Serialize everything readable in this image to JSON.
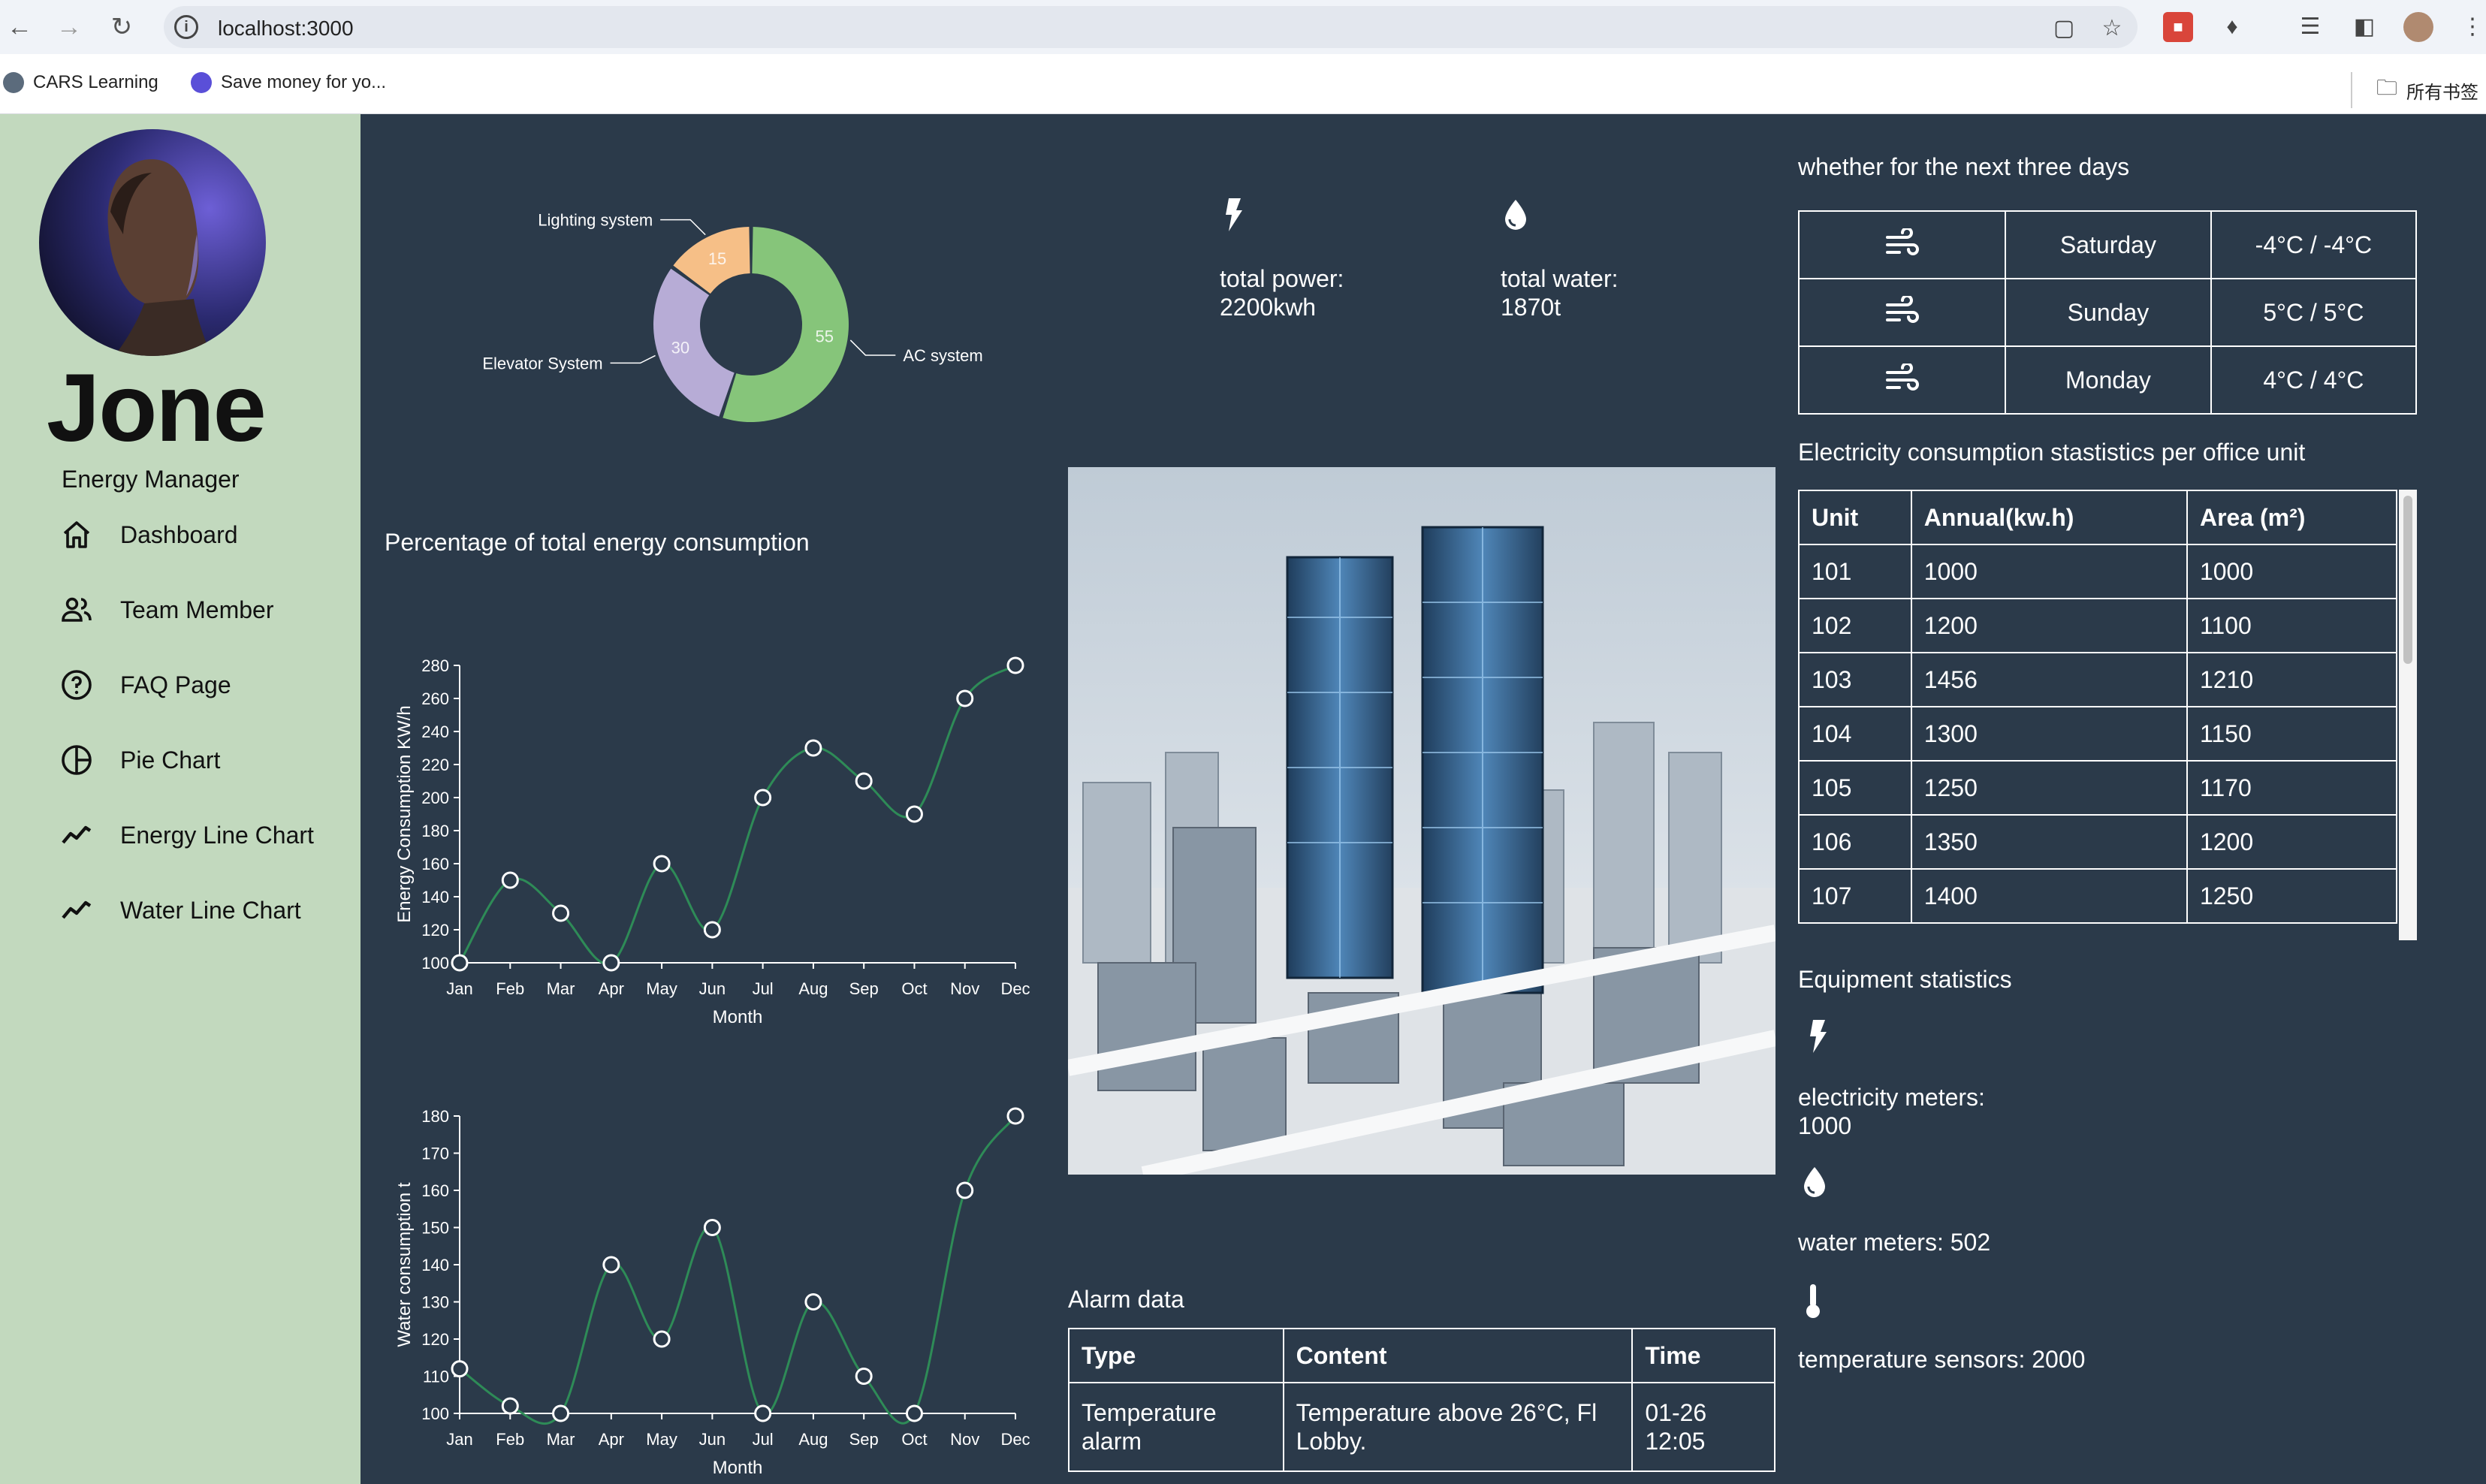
{
  "browser": {
    "url": "localhost:3000",
    "bookmarks": [
      {
        "label": "CARS Learning"
      },
      {
        "label": "Save money for yo..."
      }
    ],
    "bookmarks_folder": "所有书签"
  },
  "sidebar": {
    "user_name": "Jone",
    "user_role": "Energy Manager",
    "items": [
      {
        "label": "Dashboard",
        "icon": "home-icon"
      },
      {
        "label": "Team Member",
        "icon": "people-icon"
      },
      {
        "label": "FAQ Page",
        "icon": "help-circle-icon"
      },
      {
        "label": "Pie Chart",
        "icon": "pie-chart-icon"
      },
      {
        "label": "Energy Line Chart",
        "icon": "timeline-icon"
      },
      {
        "label": "Water Line Chart",
        "icon": "timeline-icon"
      }
    ]
  },
  "totals": {
    "power_label": "total power:",
    "power_value": "2200kwh",
    "water_label": "total water:",
    "water_value": "1870t"
  },
  "energy_title": "Percentage of total energy consumption",
  "weather": {
    "title": "whether for the next three days",
    "rows": [
      {
        "icon": "wind-icon",
        "day": "Saturday",
        "temp": "-4°C / -4°C"
      },
      {
        "icon": "wind-icon",
        "day": "Sunday",
        "temp": "5°C / 5°C"
      },
      {
        "icon": "wind-icon",
        "day": "Monday",
        "temp": "4°C / 4°C"
      }
    ]
  },
  "units": {
    "title": "Electricity consumption stastistics per office unit",
    "headers": [
      "Unit",
      "Annual(kw.h)",
      "Area (m²)"
    ],
    "rows": [
      [
        "101",
        "1000",
        "1000"
      ],
      [
        "102",
        "1200",
        "1100"
      ],
      [
        "103",
        "1456",
        "1210"
      ],
      [
        "104",
        "1300",
        "1150"
      ],
      [
        "105",
        "1250",
        "1170"
      ],
      [
        "106",
        "1350",
        "1200"
      ],
      [
        "107",
        "1400",
        "1250"
      ]
    ]
  },
  "equipment": {
    "title": "Equipment statistics",
    "electricity_label": "electricity meters:",
    "electricity_value": "1000",
    "water_text": "water meters: 502",
    "temperature_text": "temperature sensors: 2000"
  },
  "alarms": {
    "title": "Alarm data",
    "headers": [
      "Type",
      "Content",
      "Time"
    ],
    "rows": [
      [
        "Temperature alarm",
        "Temperature above 26°C, Fl Lobby.",
        "01-26 12:05"
      ]
    ]
  },
  "chart_data": [
    {
      "type": "pie",
      "labels": [
        "AC system",
        "Elevator System",
        "Lighting system"
      ],
      "values": [
        55,
        30,
        15
      ],
      "colors": [
        "#86c57a",
        "#b7acd6",
        "#f6bf87"
      ],
      "donut": true
    },
    {
      "type": "line",
      "categories": [
        "Jan",
        "Feb",
        "Mar",
        "Apr",
        "May",
        "Jun",
        "Jul",
        "Aug",
        "Sep",
        "Oct",
        "Nov",
        "Dec"
      ],
      "values": [
        100,
        150,
        130,
        100,
        160,
        120,
        200,
        230,
        210,
        190,
        260,
        280
      ],
      "xlabel": "Month",
      "ylabel": "Energy Consumption KW/h",
      "ylim": [
        100,
        280
      ],
      "yticks": [
        100,
        120,
        140,
        160,
        180,
        200,
        220,
        240,
        260,
        280
      ],
      "color": "#2e8b57"
    },
    {
      "type": "line",
      "categories": [
        "Jan",
        "Feb",
        "Mar",
        "Apr",
        "May",
        "Jun",
        "Jul",
        "Aug",
        "Sep",
        "Oct",
        "Nov",
        "Dec"
      ],
      "values": [
        112,
        102,
        100,
        140,
        120,
        150,
        100,
        130,
        110,
        100,
        160,
        180
      ],
      "xlabel": "Month",
      "ylabel": "Water consumption t",
      "ylim": [
        100,
        180
      ],
      "yticks": [
        100,
        110,
        120,
        130,
        140,
        150,
        160,
        170,
        180
      ],
      "color": "#2e8b57"
    }
  ]
}
